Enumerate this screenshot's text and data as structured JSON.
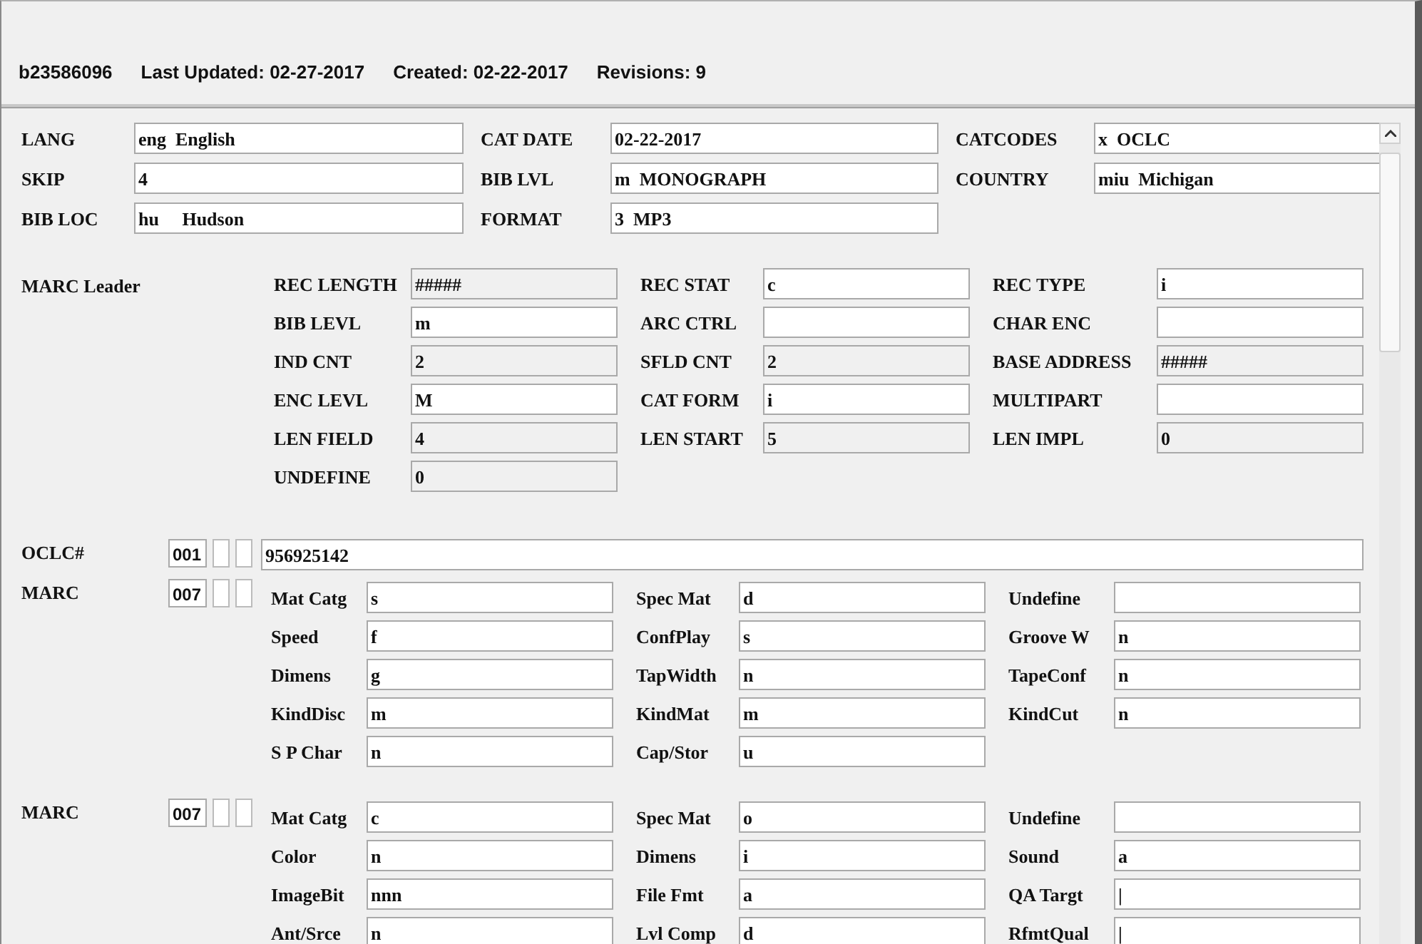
{
  "header": {
    "record_id": "b23586096",
    "items": [
      "Last Updated: 02-27-2017",
      "Created: 02-22-2017",
      "Revisions: 9"
    ]
  },
  "fixed_fields": [
    {
      "label": "LANG",
      "value": "eng  English"
    },
    {
      "label": "CAT DATE",
      "value": "02-22-2017"
    },
    {
      "label": "CATCODES",
      "value": "x  OCLC"
    },
    {
      "label": "SKIP",
      "value": "4"
    },
    {
      "label": "BIB LVL",
      "value": "m  MONOGRAPH"
    },
    {
      "label": "COUNTRY",
      "value": "miu  Michigan"
    },
    {
      "label": "BIB LOC",
      "value": "hu     Hudson"
    },
    {
      "label": "FORMAT",
      "value": "3  MP3"
    }
  ],
  "leader": {
    "title": "MARC Leader",
    "fields": [
      {
        "label": "REC LENGTH",
        "value": "#####",
        "readonly": true
      },
      {
        "label": "REC STAT",
        "value": "c",
        "readonly": false
      },
      {
        "label": "REC TYPE",
        "value": "i",
        "readonly": false
      },
      {
        "label": "BIB LEVL",
        "value": "m",
        "readonly": false
      },
      {
        "label": "ARC CTRL",
        "readonly": false
      },
      {
        "label": "CHAR ENC",
        "readonly": false
      },
      {
        "label": "IND CNT",
        "value": "2",
        "readonly": true
      },
      {
        "label": "SFLD CNT",
        "value": "2",
        "readonly": true
      },
      {
        "label": "BASE ADDRESS",
        "value": "#####",
        "readonly": true
      },
      {
        "label": "ENC LEVL",
        "value": "M",
        "readonly": false
      },
      {
        "label": "CAT FORM",
        "value": "i",
        "readonly": false
      },
      {
        "label": "MULTIPART",
        "readonly": false
      },
      {
        "label": "LEN FIELD",
        "value": "4",
        "readonly": true
      },
      {
        "label": "LEN START",
        "value": "5",
        "readonly": true
      },
      {
        "label": "LEN IMPL",
        "value": "0",
        "readonly": true
      },
      {
        "label": "UNDEFINE",
        "value": "0",
        "readonly": true
      }
    ]
  },
  "control_fields": [
    {
      "kind": "single",
      "label": "OCLC#",
      "tag": "001",
      "value": "956925142"
    },
    {
      "kind": "subfields",
      "label": "MARC",
      "tag": "007",
      "subfields": [
        {
          "label": "Mat Catg",
          "value": "s"
        },
        {
          "label": "Spec Mat",
          "value": "d"
        },
        {
          "label": "Undefine"
        },
        {
          "label": "Speed",
          "value": "f"
        },
        {
          "label": "ConfPlay",
          "value": "s"
        },
        {
          "label": "Groove W",
          "value": "n"
        },
        {
          "label": "Dimens",
          "value": "g"
        },
        {
          "label": "TapWidth",
          "value": "n"
        },
        {
          "label": "TapeConf",
          "value": "n"
        },
        {
          "label": "KindDisc",
          "value": "m"
        },
        {
          "label": "KindMat",
          "value": "m"
        },
        {
          "label": "KindCut",
          "value": "n"
        },
        {
          "label": "S P Char",
          "value": "n"
        },
        {
          "label": "Cap/Stor",
          "value": "u"
        }
      ]
    },
    {
      "kind": "subfields",
      "label": "MARC",
      "tag": "007",
      "subfields": [
        {
          "label": "Mat Catg",
          "value": "c"
        },
        {
          "label": "Spec Mat",
          "value": "o"
        },
        {
          "label": "Undefine"
        },
        {
          "label": "Color",
          "value": "n"
        },
        {
          "label": "Dimens",
          "value": "i"
        },
        {
          "label": "Sound",
          "value": "a"
        },
        {
          "label": "ImageBit",
          "value": "nnn"
        },
        {
          "label": "File Fmt",
          "value": "a"
        },
        {
          "label": "QA Targt",
          "value": "|"
        },
        {
          "label": "Ant/Srce",
          "value": "n"
        },
        {
          "label": "Lvl Comp",
          "value": "d"
        },
        {
          "label": "RfmtQual",
          "value": "|"
        }
      ]
    }
  ]
}
